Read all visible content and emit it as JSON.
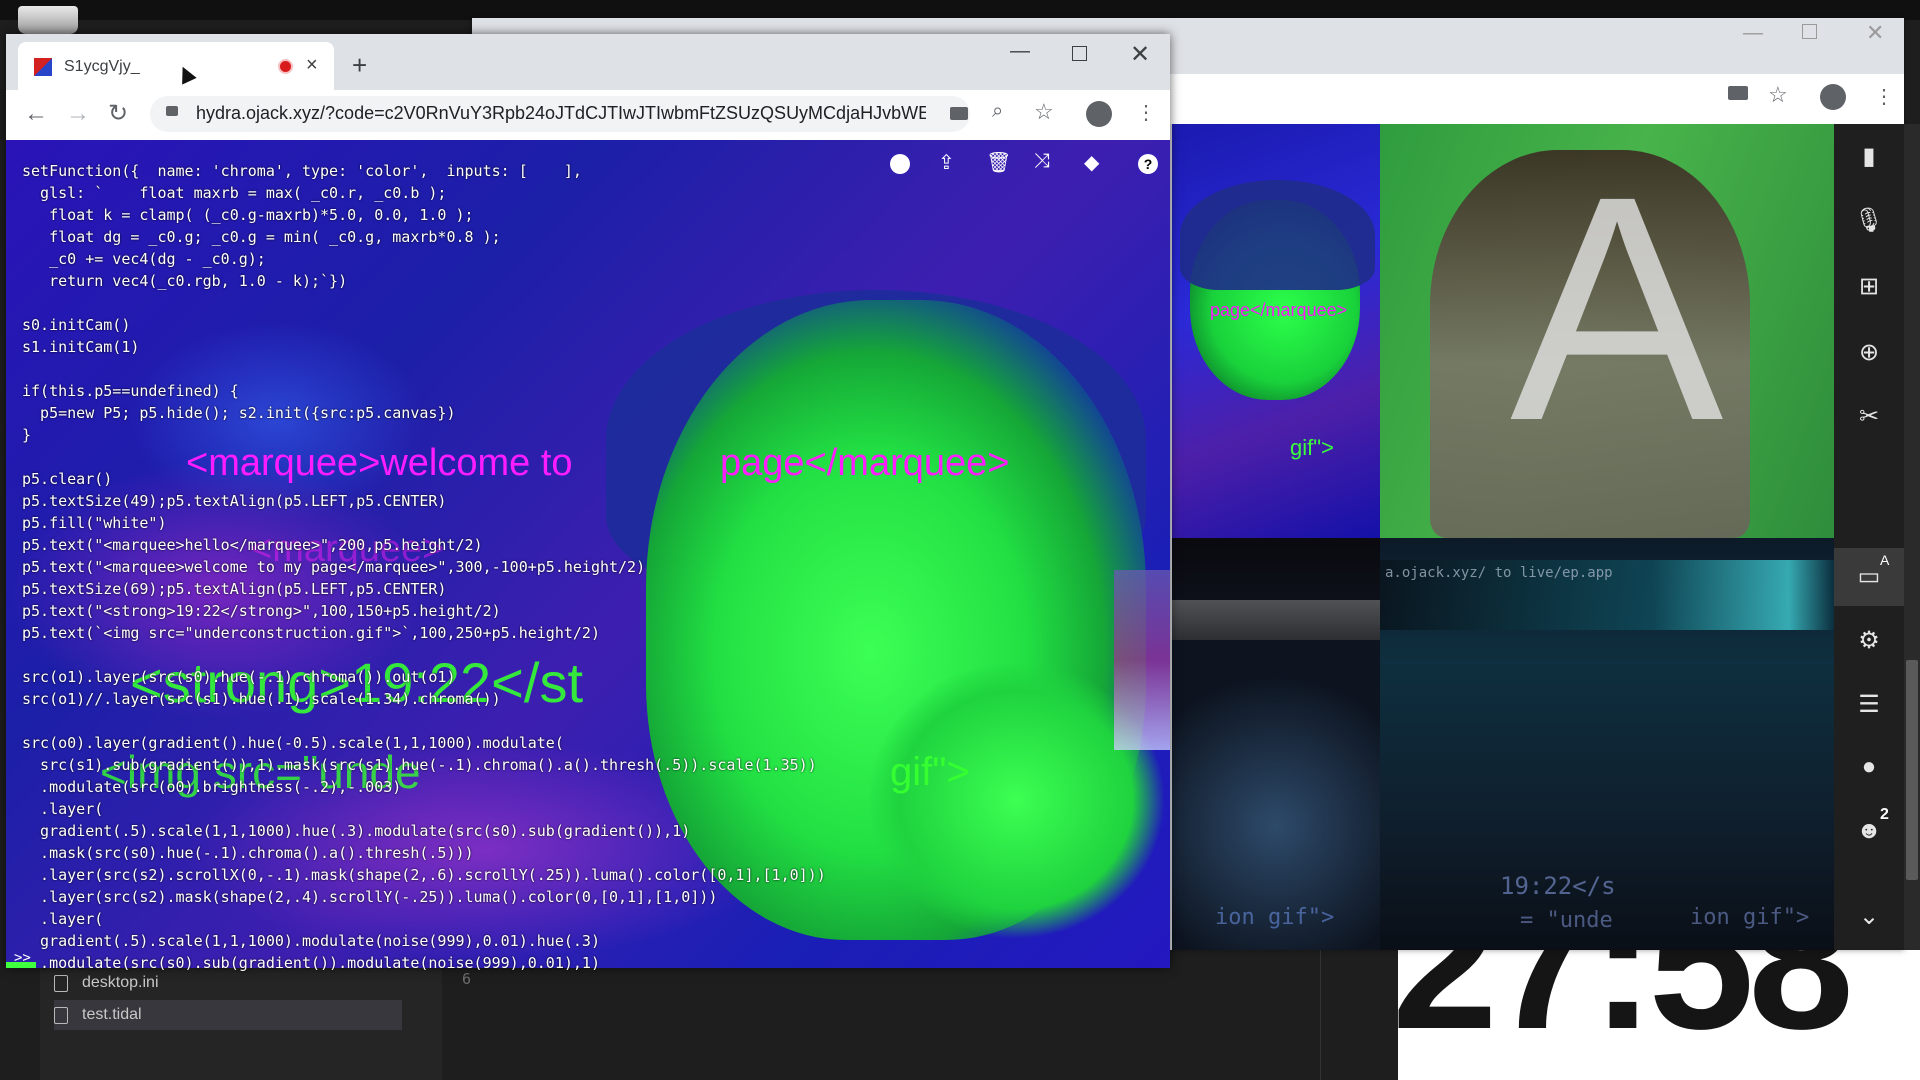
{
  "clock": {
    "time": "27:58"
  },
  "editor": {
    "files": [
      "desktop.ini",
      "test.tidal"
    ],
    "line_number": "6"
  },
  "browser_fg": {
    "tab_title": "S1ycgVjy_",
    "url": "hydra.ojack.xyz/?code=c2V0RnVuY3Rpb24oJTdCJTIwJTIwbmFtZSUzQSUyMCdjaHJvbWE...",
    "new_tab": "+",
    "tab_close": "×"
  },
  "hydra": {
    "toolbar_icons": [
      "play-icon",
      "upload-icon",
      "trash-icon",
      "shuffle-icon",
      "shapes-icon",
      "help-icon"
    ],
    "help": "?",
    "code_lines": [
      "setFunction({  name: 'chroma', type: 'color',  inputs: [    ],",
      "  glsl: `    float maxrb = max( _c0.r, _c0.b );",
      "   float k = clamp( (_c0.g-maxrb)*5.0, 0.0, 1.0 );",
      "   float dg = _c0.g; _c0.g = min( _c0.g, maxrb*0.8 );",
      "   _c0 += vec4(dg - _c0.g);",
      "   return vec4(_c0.rgb, 1.0 - k);`})",
      "",
      "s0.initCam()",
      "s1.initCam(1)",
      "",
      "if(this.p5==undefined) {",
      "  p5=new P5; p5.hide(); s2.init({src:p5.canvas})",
      "}",
      "",
      "p5.clear()",
      "p5.textSize(49);p5.textAlign(p5.LEFT,p5.CENTER)",
      "p5.fill(\"white\")",
      "p5.text(\"<marquee>hello</marquee>\",200,p5.height/2)",
      "p5.text(\"<marquee>welcome to my page</marquee>\",300,-100+p5.height/2)",
      "p5.textSize(69);p5.textAlign(p5.LEFT,p5.CENTER)",
      "p5.text(\"<strong>19:22</strong>\",100,150+p5.height/2)",
      "p5.text(`<img src=\"underconstruction.gif\">`,100,250+p5.height/2)",
      "",
      "src(o1).layer(src(s0).hue(-.1).chroma()).out(o1)",
      "src(o1)//.layer(src(s1).hue(.1).scale(1.34).chroma())",
      "",
      "src(o0).layer(gradient().hue(-0.5).scale(1,1,1000).modulate(",
      "  src(s1).sub(gradient()),1).mask(src(s1).hue(-.1).chroma().a().thresh(.5)).scale(1.35))",
      "  .modulate(src(o0).brightness(-.2),-.003)",
      "  .layer(",
      "  gradient(.5).scale(1,1,1000).hue(.3).modulate(src(s0).sub(gradient()),1)",
      "  .mask(src(s0).hue(-.1).chroma().a().thresh(.5)))",
      "  .layer(src(s2).scrollX(0,-.1).mask(shape(2,.6).scrollY(.25)).luma().color([0,1],[1,0]))",
      "  .layer(src(s2).mask(shape(2,.4).scrollY(-.25)).luma().color(0,[0,1],[1,0]))",
      "  .layer(",
      "  gradient(.5).scale(1,1,1000).modulate(noise(999),0.01).hue(.3)",
      "  .modulate(src(s0).sub(gradient()).modulate(noise(999),0.01),1)"
    ],
    "overlay_marquee_1": "<marquee>welcome to",
    "overlay_marquee_2": "page</marquee>",
    "overlay_marquee_3": "<marquee>",
    "overlay_strong": "<strong>19:22</st",
    "overlay_img": "<img src=\"unde",
    "overlay_gif": "gif\">",
    "prompt": ">>"
  },
  "call": {
    "tile1_text": "page</marquee>",
    "tile1_gif": "gif\">",
    "tile2_letter": "A",
    "tile4_url": "a.ojack.xyz/ to live/ep.app",
    "tile4_strong": "19:22</s",
    "tile3_snippet": "ion gif\">",
    "tile4_snippet": "= \"unde",
    "tile4_gif": "ion gif\">",
    "sidebar_icons": [
      "camera-icon",
      "microphone-icon",
      "screen-share-icon",
      "add-icon",
      "hangup-icon",
      "layout-icon",
      "settings-icon",
      "sliders-icon",
      "chat-icon",
      "participants-icon",
      "chevron-down-icon"
    ],
    "layout_badge": "A",
    "participants_count": "2"
  }
}
